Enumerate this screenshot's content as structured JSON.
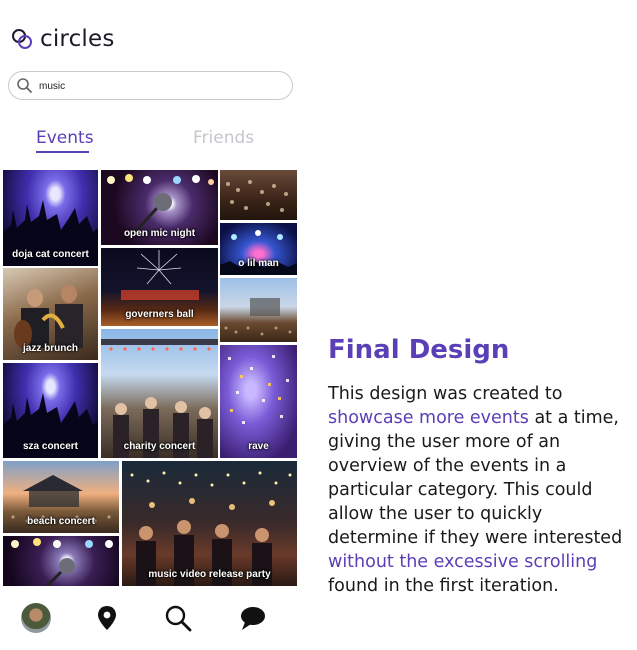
{
  "app": {
    "name": "circles"
  },
  "search": {
    "value": "music"
  },
  "tabs": [
    {
      "label": "Events",
      "active": true
    },
    {
      "label": "Friends",
      "active": false
    }
  ],
  "events": [
    {
      "label": "doja cat concert"
    },
    {
      "label": "open mic night"
    },
    {
      "label": ""
    },
    {
      "label": "o lil man"
    },
    {
      "label": "governers ball"
    },
    {
      "label": ""
    },
    {
      "label": "jazz brunch"
    },
    {
      "label": "sza concert"
    },
    {
      "label": "charity concert"
    },
    {
      "label": "rave"
    },
    {
      "label": "beach concert"
    },
    {
      "label": ""
    },
    {
      "label": "music video release party"
    }
  ],
  "bottom_nav": [
    {
      "icon": "avatar"
    },
    {
      "icon": "map-pin-icon"
    },
    {
      "icon": "search-icon"
    },
    {
      "icon": "chat-bubble-icon"
    }
  ],
  "panel": {
    "title": "Final Design",
    "desc": {
      "p1": "This design was created to ",
      "h1": "showcase more events",
      "p2": " at a time, giving the user more of an overview of the events in a particular category. This could allow the user to quickly determine if they were interested ",
      "h2": "without the excessive scrolling",
      "p3": " found in the first iteration."
    }
  },
  "colors": {
    "accent": "#5a3fb6",
    "inactive_tab": "#c5c5cc"
  }
}
